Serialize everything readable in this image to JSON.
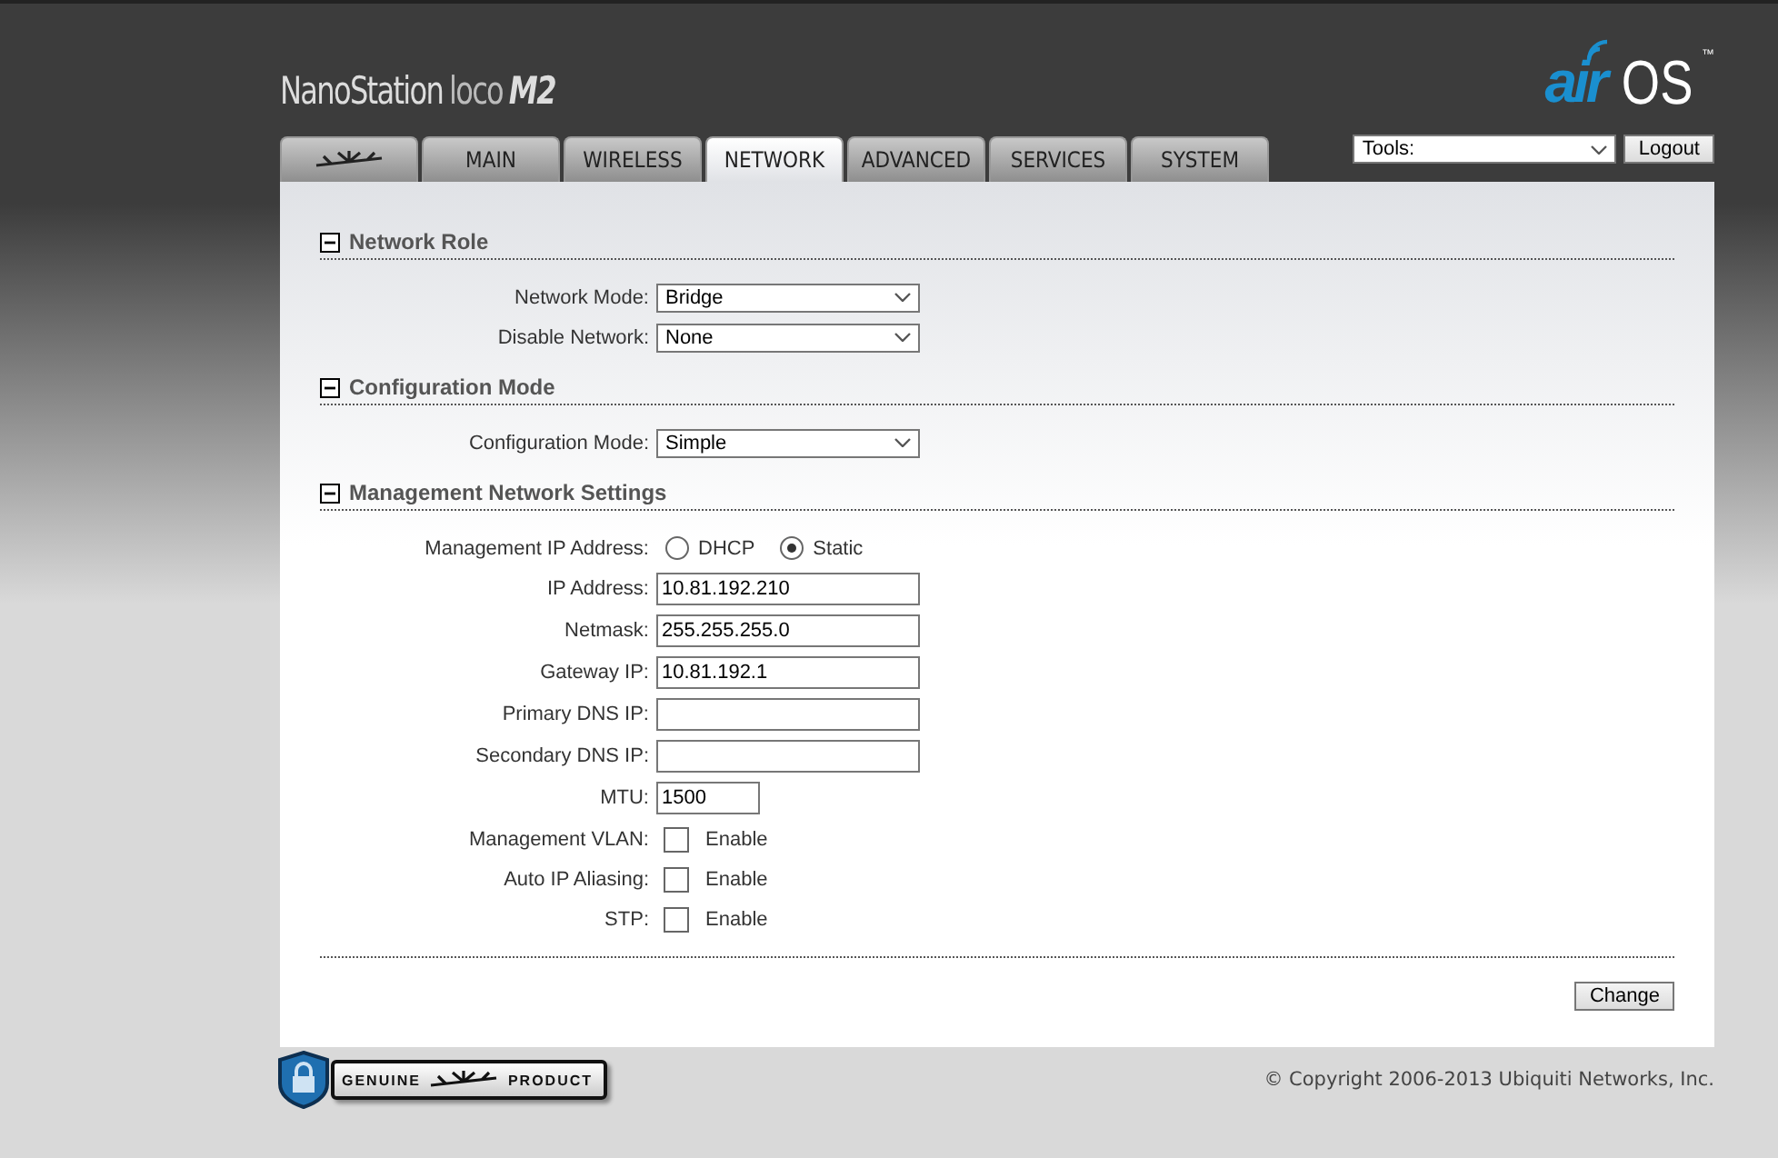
{
  "header": {
    "product": "NanoStation",
    "product_variant": "loco",
    "model": "M2",
    "brand_prefix": "air",
    "brand_suffix": "OS",
    "trademark": "™"
  },
  "tabs": [
    {
      "kind": "logo",
      "selected": false
    },
    {
      "kind": "text",
      "label": "MAIN",
      "selected": false
    },
    {
      "kind": "text",
      "label": "WIRELESS",
      "selected": false
    },
    {
      "kind": "text",
      "label": "NETWORK",
      "selected": true
    },
    {
      "kind": "text",
      "label": "ADVANCED",
      "selected": false
    },
    {
      "kind": "text",
      "label": "SERVICES",
      "selected": false
    },
    {
      "kind": "text",
      "label": "SYSTEM",
      "selected": false
    }
  ],
  "tools": {
    "value": "Tools:"
  },
  "logout_button": "Logout",
  "sections": [
    {
      "title": "Network Role",
      "expanded": true,
      "rows": [
        {
          "kind": "select",
          "label": "Network Mode:",
          "value": "Bridge"
        },
        {
          "kind": "select",
          "label": "Disable Network:",
          "value": "None"
        }
      ]
    },
    {
      "title": "Configuration Mode",
      "expanded": true,
      "rows": [
        {
          "kind": "select",
          "label": "Configuration Mode:",
          "value": "Simple"
        }
      ]
    },
    {
      "title": "Management Network Settings",
      "expanded": true,
      "rows": [
        {
          "kind": "radio",
          "label": "Management IP Address:",
          "options": [
            {
              "label": "DHCP",
              "selected": false
            },
            {
              "label": "Static",
              "selected": true
            }
          ]
        },
        {
          "kind": "text",
          "label": "IP Address:",
          "value": "10.81.192.210"
        },
        {
          "kind": "text",
          "label": "Netmask:",
          "value": "255.255.255.0"
        },
        {
          "kind": "text",
          "label": "Gateway IP:",
          "value": "10.81.192.1"
        },
        {
          "kind": "text",
          "label": "Primary DNS IP:"
        },
        {
          "kind": "text",
          "label": "Secondary DNS IP:"
        },
        {
          "kind": "short",
          "label": "MTU:",
          "value": "1500"
        },
        {
          "kind": "checkbox",
          "label": "Management VLAN:",
          "option": "Enable",
          "checked": false
        },
        {
          "kind": "checkbox",
          "label": "Auto IP Aliasing:",
          "option": "Enable",
          "checked": false
        },
        {
          "kind": "checkbox",
          "label": "STP:",
          "option": "Enable",
          "checked": false
        }
      ]
    }
  ],
  "change_button": "Change",
  "footer": {
    "badge_left": "GENUINE",
    "badge_right": "PRODUCT",
    "copyright": "© Copyright 2006-2013 Ubiquiti Networks, Inc."
  }
}
